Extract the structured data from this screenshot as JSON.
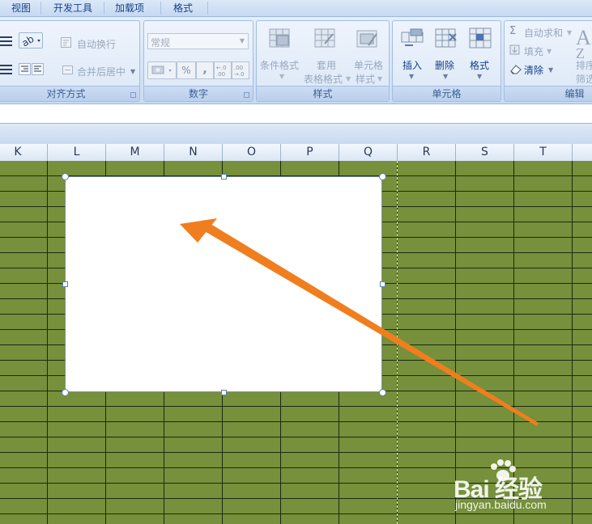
{
  "ribbon_tabs": [
    {
      "label": "视图"
    },
    {
      "label": "开发工具"
    },
    {
      "label": "加载项"
    },
    {
      "label": "格式"
    }
  ],
  "alignment_group": {
    "title": "对齐方式",
    "wrap_text": "自动换行",
    "merge_center": "合并后居中"
  },
  "number_group": {
    "title": "数字",
    "format_value": "常规",
    "percent_symbol": "%",
    "comma_symbol": ",",
    "increase_decimal": "+.0 .00",
    "decrease_decimal": ".00 →.0"
  },
  "styles_group": {
    "title": "样式",
    "conditional_format": "条件格式",
    "format_as_table_1": "套用",
    "format_as_table_2": "表格格式",
    "cell_styles_1": "单元格",
    "cell_styles_2": "样式"
  },
  "cells_group": {
    "title": "单元格",
    "insert": "插入",
    "delete": "删除",
    "format": "格式"
  },
  "editing_group": {
    "title": "编辑",
    "autosum": "自动求和",
    "fill": "填充",
    "clear": "清除",
    "sort_1": "排序",
    "sort_2": "筛选"
  },
  "columns": [
    "K",
    "L",
    "M",
    "N",
    "O",
    "P",
    "Q",
    "R",
    "S",
    "T"
  ],
  "colors": {
    "grid_fill": "#76903b",
    "arrow": "#f07e1e",
    "ribbon": "#d7e4f5"
  },
  "watermark": {
    "brand": "Bai 经验",
    "site": "jingyan.baidu.com"
  }
}
